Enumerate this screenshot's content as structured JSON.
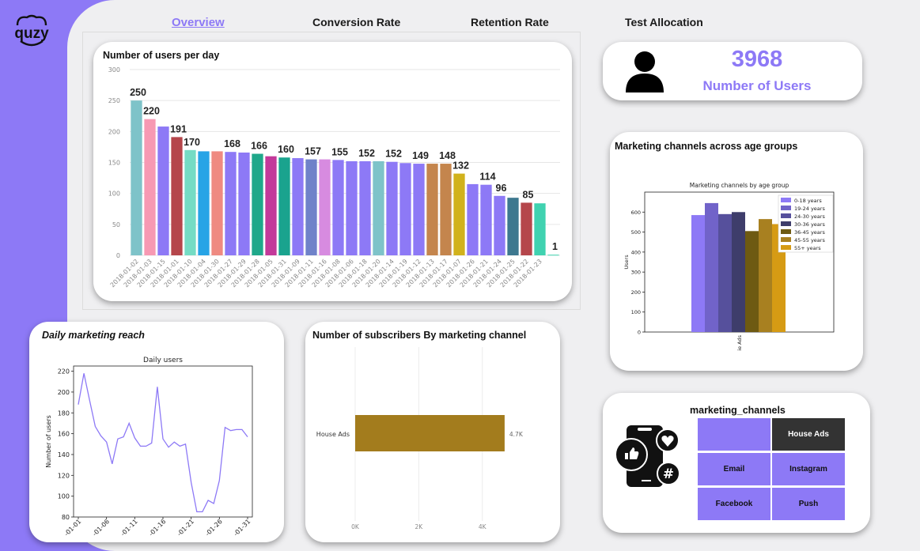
{
  "logo": {
    "text": "quzy"
  },
  "nav": [
    {
      "label": "Overview",
      "active": true
    },
    {
      "label": "Conversion Rate",
      "active": false
    },
    {
      "label": "Retention Rate",
      "active": false
    },
    {
      "label": "Test Allocation",
      "active": false
    }
  ],
  "kpi": {
    "value": "3968",
    "label": "Number of Users",
    "icon": "user-icon"
  },
  "users_per_day": {
    "title": "Number of users per day",
    "chart_data": {
      "type": "bar",
      "ylim": [
        0,
        300
      ],
      "yticks": [
        0,
        50,
        100,
        150,
        200,
        250,
        300
      ],
      "categories": [
        "2018-01-02",
        "2018-01-03",
        "2018-01-15",
        "2018-01-01",
        "2018-01-10",
        "2018-01-04",
        "2018-01-30",
        "2018-01-27",
        "2018-01-29",
        "2018-01-28",
        "2018-01-05",
        "2018-01-31",
        "2018-01-09",
        "2018-01-11",
        "2018-01-16",
        "2018-01-08",
        "2018-01-06",
        "2018-01-18",
        "2018-01-20",
        "2018-01-14",
        "2018-01-19",
        "2018-01-12",
        "2018-01-13",
        "2018-01-17",
        "2018-01-07",
        "2018-01-26",
        "2018-01-21",
        "2018-01-24",
        "2018-01-25",
        "2018-01-22",
        "2018-01-23"
      ],
      "values": [
        250,
        220,
        208,
        191,
        170,
        168,
        168,
        167,
        166,
        164,
        160,
        158,
        157,
        155,
        155,
        154,
        152,
        152,
        152,
        151,
        149,
        148,
        148,
        148,
        132,
        115,
        114,
        96,
        93,
        85,
        84,
        1
      ],
      "labels": [
        {
          "i": 0,
          "text": "250"
        },
        {
          "i": 1,
          "text": "220"
        },
        {
          "i": 3,
          "text": "191"
        },
        {
          "i": 4,
          "text": "170"
        },
        {
          "i": 7,
          "text": "168"
        },
        {
          "i": 9,
          "text": "166"
        },
        {
          "i": 11,
          "text": "160"
        },
        {
          "i": 13,
          "text": "157"
        },
        {
          "i": 15,
          "text": "155"
        },
        {
          "i": 17,
          "text": "152"
        },
        {
          "i": 19,
          "text": "152"
        },
        {
          "i": 21,
          "text": "149"
        },
        {
          "i": 23,
          "text": "148"
        },
        {
          "i": 24,
          "text": "132"
        },
        {
          "i": 26,
          "text": "114"
        },
        {
          "i": 27,
          "text": "96"
        },
        {
          "i": 29,
          "text": "85"
        },
        {
          "i": 31,
          "text": "1"
        }
      ],
      "colors": [
        "#7ec3c9",
        "#f799b3",
        "#8d79f6",
        "#b5464b",
        "#75dcc4",
        "#27a4e6",
        "#ef8a81",
        "#8d79f6",
        "#8d79f6",
        "#1fa88a",
        "#c3399a",
        "#1aa38e",
        "#8d79f6",
        "#6f82c9",
        "#d78be0",
        "#8d79f6",
        "#8d79f6",
        "#8d79f6",
        "#7ec3c9",
        "#8d79f6",
        "#8d79f6",
        "#8d79f6",
        "#c4854d",
        "#c4854d",
        "#d1b21c",
        "#8d79f6",
        "#8d79f6",
        "#8d79f6",
        "#3d788f",
        "#b5464b",
        "#40d2b0",
        "#40d2b0"
      ]
    }
  },
  "age_groups": {
    "title": "Marketing channels across age groups",
    "chart_data": {
      "type": "bar",
      "title": "Marketing channels by age group",
      "ylabel": "Users",
      "xtick": "House Ads",
      "xtick_visible": "ie Ads",
      "ylim": [
        0,
        700
      ],
      "yticks": [
        0,
        100,
        200,
        300,
        400,
        500,
        600
      ],
      "series": [
        {
          "name": "0-18 years",
          "value": 585,
          "color": "#8d79f6"
        },
        {
          "name": "19-24 years",
          "value": 645,
          "color": "#7163c9"
        },
        {
          "name": "24-30 years",
          "value": 590,
          "color": "#56509c"
        },
        {
          "name": "30-36 years",
          "value": 600,
          "color": "#3e3d6b"
        },
        {
          "name": "36-45 years",
          "value": 505,
          "color": "#6e5a12"
        },
        {
          "name": "45-55 years",
          "value": 565,
          "color": "#a88020"
        },
        {
          "name": "55+ years",
          "value": 540,
          "color": "#d69b14"
        }
      ]
    }
  },
  "daily_reach": {
    "title": "Daily marketing reach",
    "chart_data": {
      "type": "line",
      "title": "Daily users",
      "ylabel": "Number of users",
      "ylim": [
        80,
        225
      ],
      "yticks": [
        80,
        100,
        120,
        140,
        160,
        180,
        200,
        220
      ],
      "xticks": [
        "-01-01",
        "-01-06",
        "-01-11",
        "-01-16",
        "-01-21",
        "-01-26",
        "-01-31"
      ],
      "x": [
        1,
        2,
        3,
        4,
        5,
        6,
        7,
        8,
        9,
        10,
        11,
        12,
        13,
        14,
        15,
        16,
        17,
        18,
        19,
        20,
        21,
        22,
        23,
        24,
        25,
        26,
        27,
        28,
        29,
        30,
        31
      ],
      "values": [
        188,
        218,
        192,
        167,
        158,
        152,
        131,
        155,
        157,
        170,
        156,
        148,
        148,
        151,
        205,
        155,
        147,
        152,
        148,
        150,
        113,
        85,
        85,
        96,
        93,
        115,
        166,
        163,
        164,
        164,
        157
      ],
      "color": "#8d79f6"
    }
  },
  "subscribers": {
    "title": "Number of subscribers By marketing channel",
    "chart_data": {
      "type": "bar",
      "orientation": "horizontal",
      "categories": [
        "House Ads"
      ],
      "values": [
        4700
      ],
      "value_label": "4.7K",
      "xticks": [
        "0K",
        "2K",
        "4K"
      ],
      "xtick_values": [
        0,
        2000,
        4000
      ],
      "xlim": [
        0,
        5200
      ],
      "color": "#a37c1d"
    }
  },
  "channels": {
    "title": "marketing_channels",
    "icon": "social-phone-icon",
    "tiles": [
      {
        "label": "",
        "selected": false
      },
      {
        "label": "House Ads",
        "selected": true
      },
      {
        "label": "Email",
        "selected": false
      },
      {
        "label": "Instagram",
        "selected": false
      },
      {
        "label": "Facebook",
        "selected": false
      },
      {
        "label": "Push",
        "selected": false
      }
    ]
  }
}
